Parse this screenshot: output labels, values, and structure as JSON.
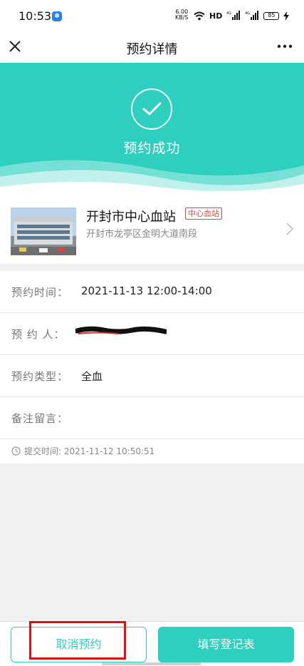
{
  "status_bar": {
    "time": "10:53",
    "speed_value": "6.00",
    "speed_unit": "KB/S",
    "network_label": "HD",
    "battery": "85"
  },
  "nav": {
    "title": "预约详情",
    "close_icon": "close-icon",
    "more_icon": "more-icon"
  },
  "hero": {
    "status_title": "预约成功",
    "icon": "check-icon",
    "color": "#2fcfc0"
  },
  "station": {
    "name": "开封市中心血站",
    "badge": "中心血站",
    "address": "开封市龙亭区金明大道南段"
  },
  "details": {
    "rows": [
      {
        "label": "预约时间：",
        "value": "2021-11-13 12:00-14:00"
      },
      {
        "label": "预 约 人：",
        "value": ""
      },
      {
        "label": "预约类型：",
        "value": "全血"
      },
      {
        "label": "备注留言：",
        "value": ""
      }
    ],
    "submit_time": "提交时间: 2021-11-12 10:50:51"
  },
  "actions": {
    "cancel_label": "取消预约",
    "fill_label": "填写登记表",
    "accent_color": "#2fcfc0",
    "highlight_color": "#e01010"
  }
}
